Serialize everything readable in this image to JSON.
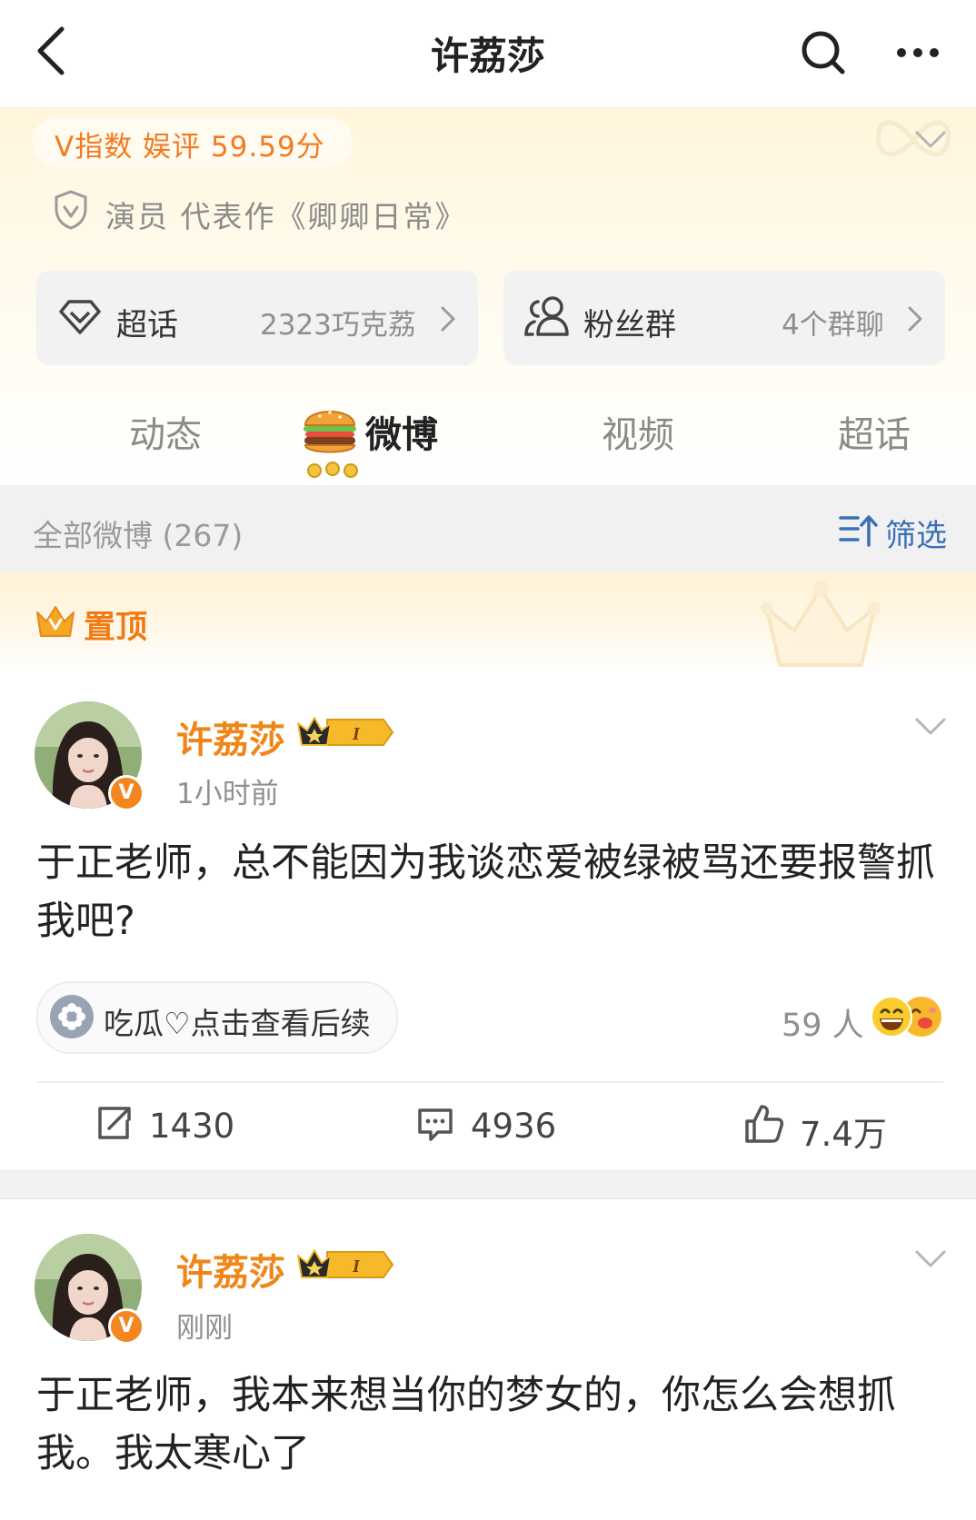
{
  "nav": {
    "title": "许荔莎"
  },
  "profile": {
    "v_index": "V指数 娱评 59.59分",
    "role": "演员 代表作《卿卿日常》",
    "chaohua": {
      "label": "超话",
      "value": "2323巧克荔"
    },
    "fans": {
      "label": "粉丝群",
      "value": "4个群聊"
    }
  },
  "tabs": [
    {
      "label": "动态"
    },
    {
      "label": "微博",
      "active": true
    },
    {
      "label": "视频"
    },
    {
      "label": "超话"
    }
  ],
  "section": {
    "count_label": "全部微博 (267)",
    "filter_label": "筛选"
  },
  "pinned": {
    "label": "置顶"
  },
  "posts": [
    {
      "author": "许荔莎",
      "time": "1小时前",
      "text": "于正老师，总不能因为我谈恋爱被绿被骂还要报警抓我吧?",
      "topic": "吃瓜♡点击查看后续",
      "reactions": "59 人",
      "reposts": "1430",
      "comments": "4936",
      "likes": "7.4万"
    },
    {
      "author": "许荔莎",
      "time": "刚刚",
      "text": "于正老师，我本来想当你的梦女的，你怎么会想抓我。我太寒心了"
    }
  ],
  "colors": {
    "accent": "#f08519",
    "link": "#3b6fb6",
    "badge": "#f3861e"
  }
}
